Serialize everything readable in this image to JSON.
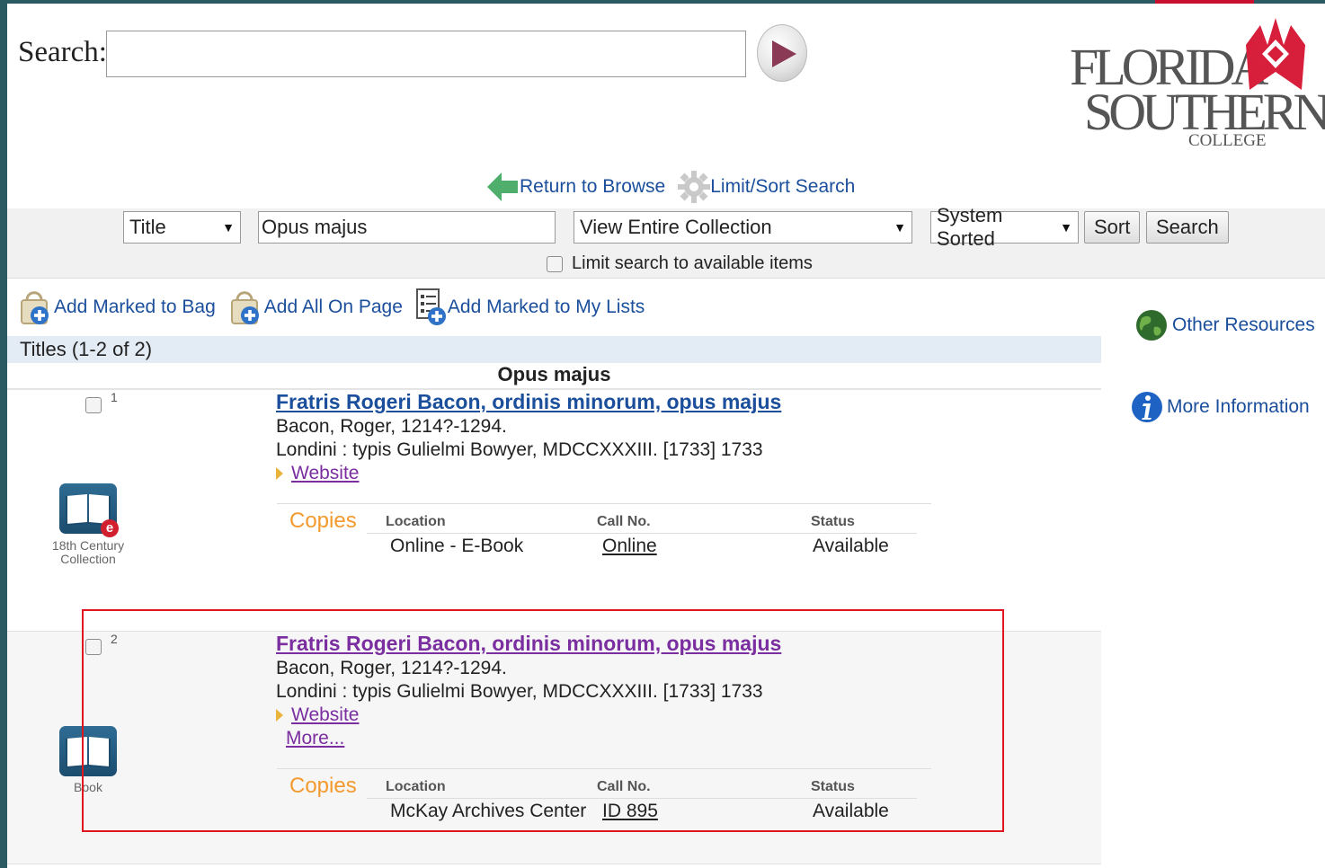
{
  "search": {
    "label": "Search:",
    "value": ""
  },
  "logo": {
    "line1": "FLORIDA",
    "line2": "SOUTHERN",
    "line3": "COLLEGE"
  },
  "nav": {
    "return_label": "Return to Browse",
    "limit_sort_label": "Limit/Sort Search"
  },
  "form": {
    "field_select": "Title",
    "query_value": "Opus majus",
    "collection_select": "View Entire Collection",
    "sort_select": "System Sorted",
    "sort_button": "Sort",
    "search_button": "Search",
    "limit_label": "Limit search to available items"
  },
  "actions": {
    "add_marked_bag": "Add Marked to Bag",
    "add_all_page": "Add All On Page",
    "add_marked_lists": "Add Marked to My Lists"
  },
  "results_header": {
    "titles_count": "Titles (1-2 of 2)",
    "group_heading": "Opus majus"
  },
  "results": [
    {
      "number": "1",
      "title": "Fratris Rogeri Bacon, ordinis minorum, opus majus",
      "author": "Bacon, Roger, 1214?-1294.",
      "publication": "Londini : typis Gulielmi Bowyer, MDCCXXXIII. [1733] 1733",
      "website_label": "Website",
      "format_caption": "18th Century Collection",
      "format_badge": "e",
      "copies": {
        "label": "Copies",
        "headers": [
          "Location",
          "Call No.",
          "Status"
        ],
        "location": "Online - E-Book",
        "call_no": "Online",
        "status": "Available"
      }
    },
    {
      "number": "2",
      "title": "Fratris Rogeri Bacon, ordinis minorum, opus majus",
      "author": "Bacon, Roger, 1214?-1294.",
      "publication": "Londini : typis Gulielmi Bowyer, MDCCXXXIII. [1733] 1733",
      "website_label": "Website",
      "more_label": "More...",
      "format_caption": "Book",
      "copies": {
        "label": "Copies",
        "headers": [
          "Location",
          "Call No.",
          "Status"
        ],
        "location": "McKay Archives Center",
        "call_no": "ID 895",
        "status": "Available"
      }
    }
  ],
  "sidebar": {
    "other_resources": "Other Resources",
    "more_information": "More Information"
  },
  "colors": {
    "link": "#1b4f9c",
    "visited_link": "#7a2ea0",
    "copies_orange": "#f39a2e",
    "brand_red": "#c8102e",
    "highlight_red": "#e0161e"
  }
}
